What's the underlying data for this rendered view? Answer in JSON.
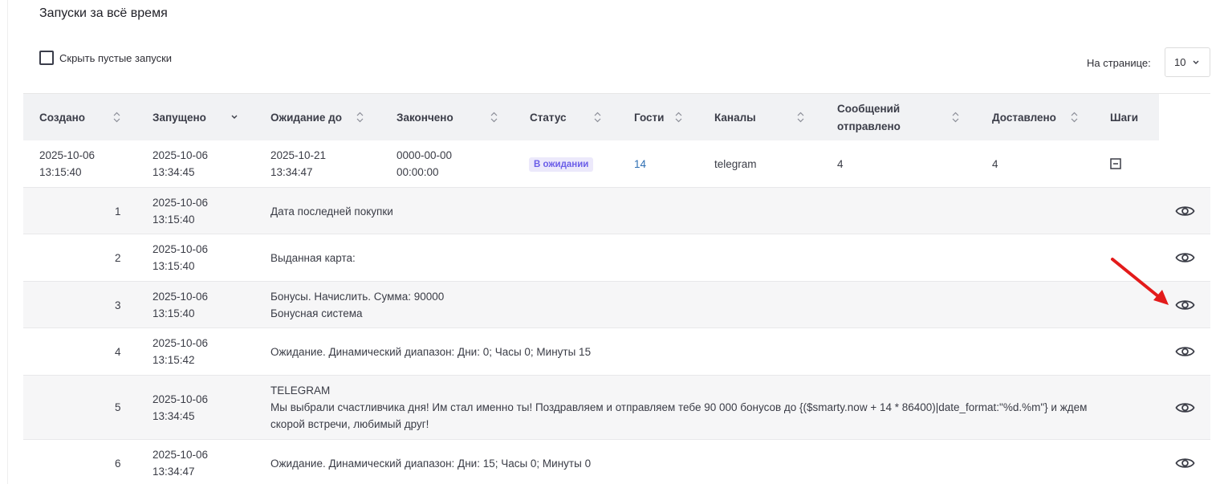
{
  "header": {
    "title": "Запуски за всё время",
    "hide_empty_label": "Скрыть пустые запуски",
    "hide_empty_checked": false,
    "per_page_label": "На странице:",
    "per_page_value": "10"
  },
  "table": {
    "columns": [
      {
        "label": "Создано",
        "sort": "none"
      },
      {
        "label": "Запущено",
        "sort": "desc"
      },
      {
        "label": "Ожидание до",
        "sort": "none"
      },
      {
        "label": "Закончено",
        "sort": "none"
      },
      {
        "label": "Статус",
        "sort": "none"
      },
      {
        "label": "Гости",
        "sort": "none"
      },
      {
        "label": "Каналы",
        "sort": "none"
      },
      {
        "label": "Сообщений отправлено",
        "sort": "none"
      },
      {
        "label": "Доставлено",
        "sort": "none"
      },
      {
        "label": "Шаги"
      }
    ],
    "run": {
      "created_date": "2025-10-06",
      "created_time": "13:15:40",
      "started_date": "2025-10-06",
      "started_time": "13:34:45",
      "wait_until_date": "2025-10-21",
      "wait_until_time": "13:34:47",
      "finished_date": "0000-00-00",
      "finished_time": "00:00:00",
      "status": "В ожидании",
      "guests": "14",
      "channels": "telegram",
      "messages_sent": "4",
      "delivered": "4"
    },
    "steps": [
      {
        "num": "1",
        "date": "2025-10-06",
        "time": "13:15:40",
        "lines": [
          "Дата последней покупки"
        ]
      },
      {
        "num": "2",
        "date": "2025-10-06",
        "time": "13:15:40",
        "lines": [
          "Выданная карта:"
        ]
      },
      {
        "num": "3",
        "date": "2025-10-06",
        "time": "13:15:40",
        "lines": [
          "Бонусы. Начислить. Сумма: 90000",
          "Бонусная система"
        ]
      },
      {
        "num": "4",
        "date": "2025-10-06",
        "time": "13:15:42",
        "lines": [
          "Ожидание. Динамический диапазон: Дни: 0; Часы 0; Минуты 15"
        ]
      },
      {
        "num": "5",
        "date": "2025-10-06",
        "time": "13:34:45",
        "lines": [
          "TELEGRAM",
          "Мы выбрали счастливчика дня! Им стал именно ты! Поздравляем и отправляем тебе 90 000 бонусов до {($smarty.now + 14 * 86400)|date_format:\"%d.%m\"} и ждем",
          "скорой встречи, любимый друг!"
        ]
      },
      {
        "num": "6",
        "date": "2025-10-06",
        "time": "13:34:47",
        "lines": [
          "Ожидание. Динамический диапазон: Дни: 15; Часы 0; Минуты 0"
        ]
      }
    ]
  },
  "icons": {
    "sort": "sort-arrows-icon",
    "sort_desc": "chevron-down-icon",
    "view": "eye-icon",
    "collapse": "minus-square-icon",
    "annotation": "red-arrow"
  },
  "colors": {
    "header_bg": "#f1f2f4",
    "badge_bg": "#ece9fb",
    "badge_text": "#6b5ee8",
    "link": "#2f6fb3",
    "annotation_arrow": "#e31b1b"
  }
}
